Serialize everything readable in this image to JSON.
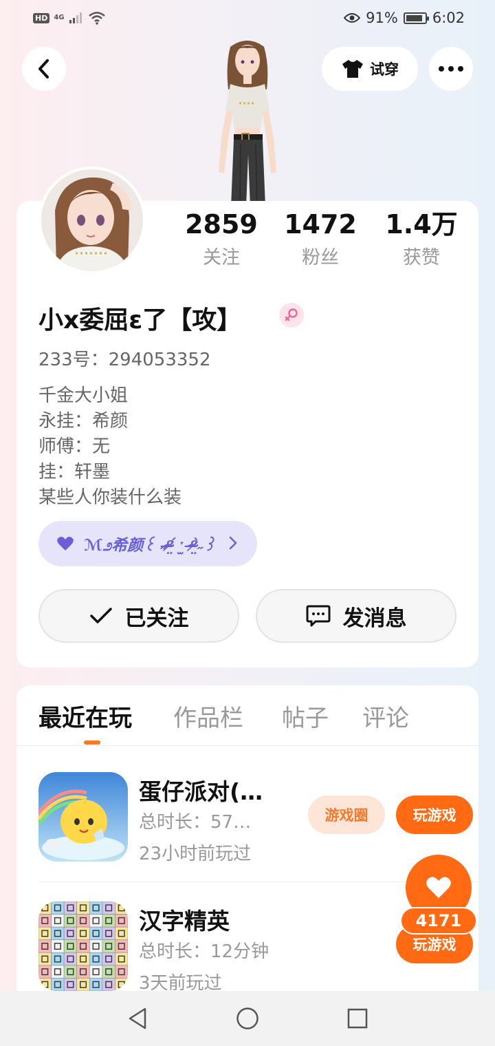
{
  "status_bar": {
    "hd_label": "HD",
    "network_label": "4G",
    "battery_percent": "91%",
    "battery_level": 0.91,
    "time": "6:02"
  },
  "header": {
    "back_icon": "chevron-left-icon",
    "tryon_label": "试穿",
    "tryon_icon": "tshirt-icon",
    "more_icon": "more-dots-icon"
  },
  "profile": {
    "stats": [
      {
        "value": "2859",
        "label": "关注"
      },
      {
        "value": "1472",
        "label": "粉丝"
      },
      {
        "value": "1.4万",
        "label": "获赞"
      }
    ],
    "nickname": "小x委屈ɛ了【攻】",
    "gender_icon": "female-icon",
    "uid": "233号：294053352",
    "bio_lines": [
      "千金大小姐",
      "永挂：希颜",
      "师傅：无",
      "挂：轩墨",
      "某些人你装什么装"
    ],
    "bond_tag": "ℳ೨希颜꒰ ˶ᵒ̴̶̷̤́ ˑ̫ ᵒ̴̶̷̤̀˶꒱",
    "follow_label": "已关注",
    "message_label": "发消息"
  },
  "tabs": {
    "items": [
      "最近在玩",
      "作品栏",
      "帖子",
      "评论"
    ],
    "active_index": 0
  },
  "games": [
    {
      "title": "蛋仔派对(…",
      "duration": "总时长：57…",
      "last_played": "23小时前玩过",
      "circle_label": "游戏圈",
      "play_label": "玩游戏"
    },
    {
      "title": "汉字精英",
      "duration": "总时长：12分钟",
      "last_played": "3天前玩过",
      "play_label": "玩游戏"
    }
  ],
  "like_fab": {
    "count": "4171",
    "icon": "heart-icon"
  },
  "colors": {
    "accent": "#ff6a13",
    "accent_soft": "#fde6d8",
    "bond_bg": "#e6e4fb",
    "bond_text": "#6a5fd8"
  }
}
